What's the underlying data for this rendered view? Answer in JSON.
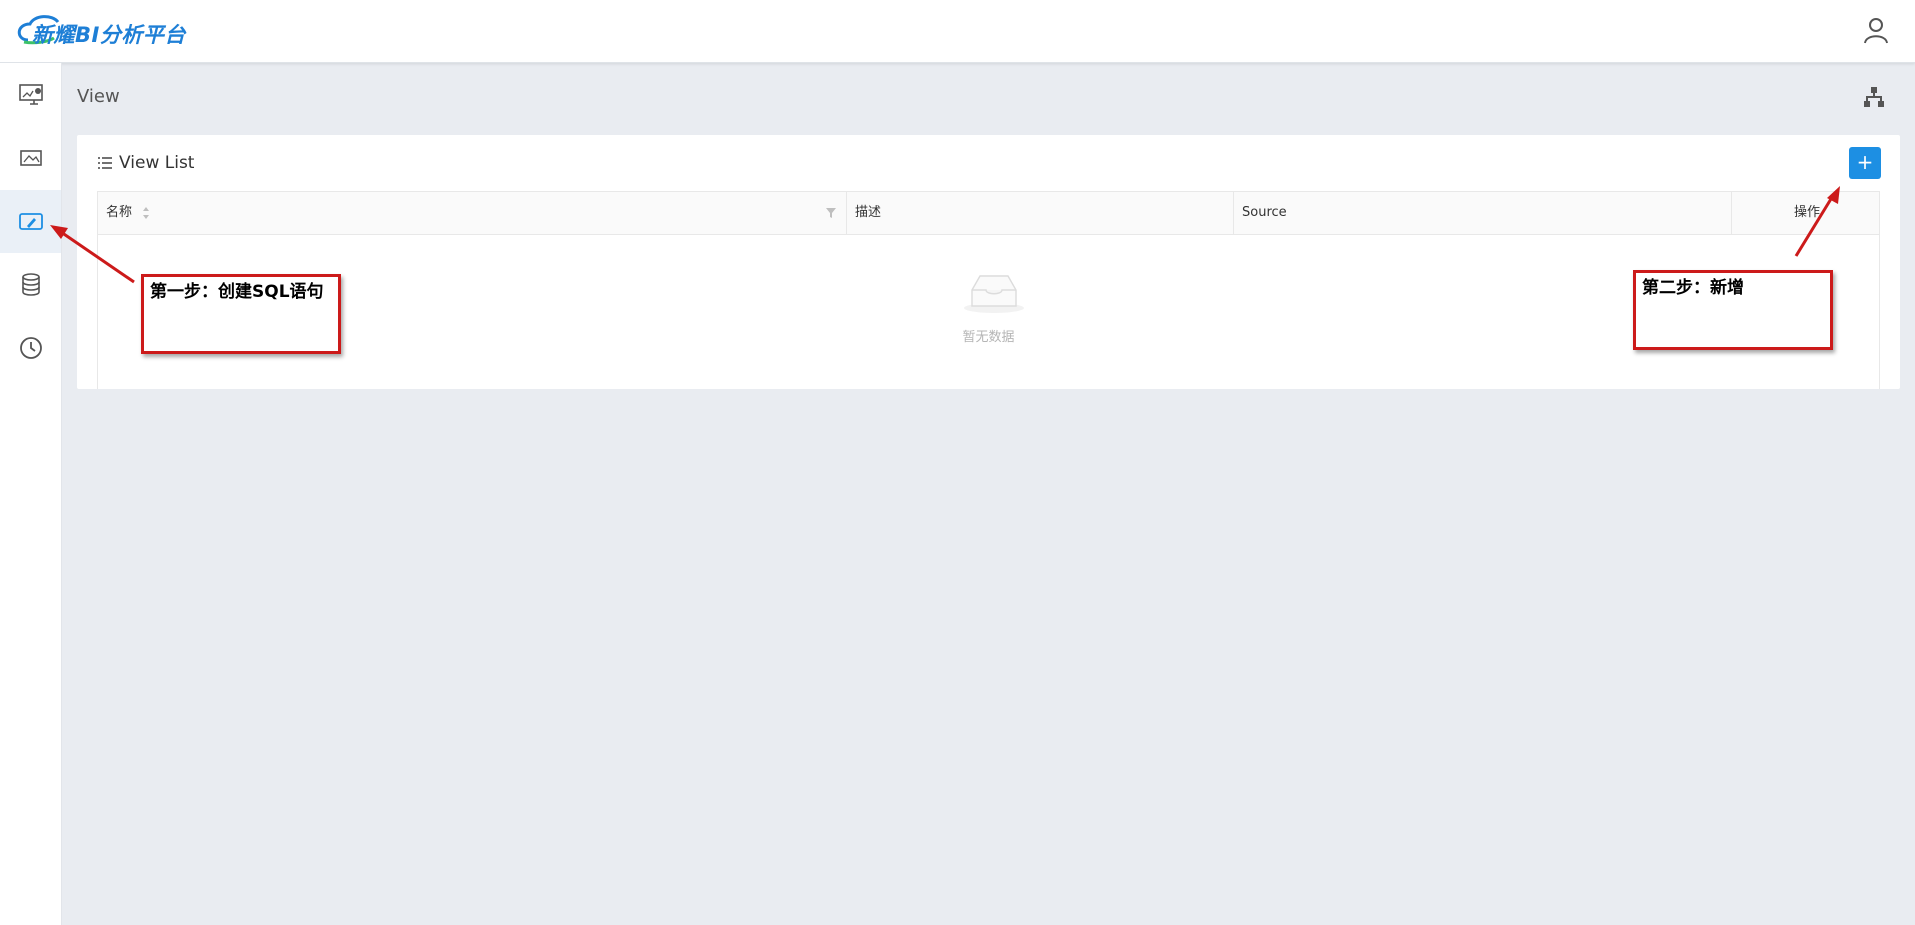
{
  "header": {
    "logo_text": "新耀BI分析平台",
    "user_icon": "user-icon"
  },
  "sidebar": {
    "items": [
      {
        "name": "dashboard",
        "icon": "monitor-chart-icon",
        "active": false
      },
      {
        "name": "widget",
        "icon": "image-frame-icon",
        "active": false
      },
      {
        "name": "view",
        "icon": "edit-screen-icon",
        "active": true
      },
      {
        "name": "source",
        "icon": "database-icon",
        "active": false
      },
      {
        "name": "schedule",
        "icon": "clock-icon",
        "active": false
      }
    ]
  },
  "page": {
    "breadcrumb": "View",
    "card_title": "View List",
    "add_label": "+",
    "columns": {
      "name": "名称",
      "description": "描述",
      "source": "Source",
      "actions": "操作"
    },
    "empty_text": "暂无数据"
  },
  "annotations": {
    "step1": "第一步：创建SQL语句",
    "step2": "第二步：新增"
  },
  "colors": {
    "primary": "#1d8fe3",
    "annotation_red": "#cc1a1a",
    "background": "#e9ecf1"
  }
}
